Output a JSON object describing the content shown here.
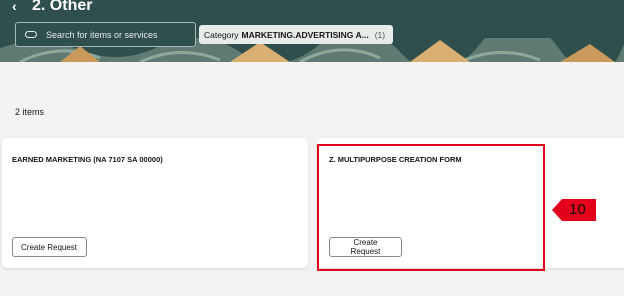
{
  "header": {
    "back_icon": "chevron-left-icon",
    "title": "2. Other",
    "background_color": "#2f4f4d"
  },
  "search": {
    "icon": "search-icon",
    "placeholder": "Search for items or services"
  },
  "filter_chip": {
    "label": "Category",
    "value": "MARKETING.ADVERTISING A...",
    "count": "(1)"
  },
  "results": {
    "count_label": "2 items"
  },
  "cards": [
    {
      "title": "EARNED MARKETING (NA 7107 SA 00000)",
      "button_label": "Create Request"
    },
    {
      "title": "Z. MULTIPURPOSE CREATION FORM",
      "button_label": "Create Request"
    }
  ],
  "annotation": {
    "step_number": "10",
    "color": "#e2001a"
  }
}
